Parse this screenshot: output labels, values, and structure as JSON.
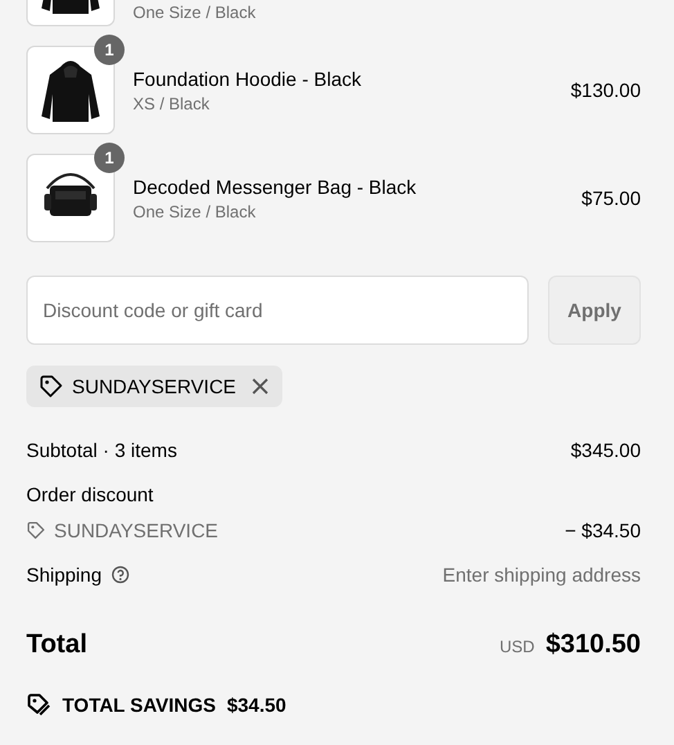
{
  "items": [
    {
      "variant": "One Size / Black",
      "kind": "hoodie"
    },
    {
      "name": "Foundation Hoodie - Black",
      "variant": "XS / Black",
      "price": "$130.00",
      "quantity": "1",
      "kind": "hoodie"
    },
    {
      "name": "Decoded Messenger Bag - Black",
      "variant": "One Size / Black",
      "price": "$75.00",
      "quantity": "1",
      "kind": "bag"
    }
  ],
  "discount": {
    "placeholder": "Discount code or gift card",
    "button": "Apply",
    "applied_code": "SUNDAYSERVICE"
  },
  "summary": {
    "subtotal_label": "Subtotal · 3 items",
    "subtotal": "$345.00",
    "discount_label": "Order discount",
    "discount_code": "SUNDAYSERVICE",
    "discount_amount": "− $34.50",
    "shipping_label": "Shipping",
    "shipping_value": "Enter shipping address",
    "total_label": "Total",
    "currency": "USD",
    "total": "$310.50",
    "savings_label": "TOTAL SAVINGS",
    "savings": "$34.50"
  }
}
